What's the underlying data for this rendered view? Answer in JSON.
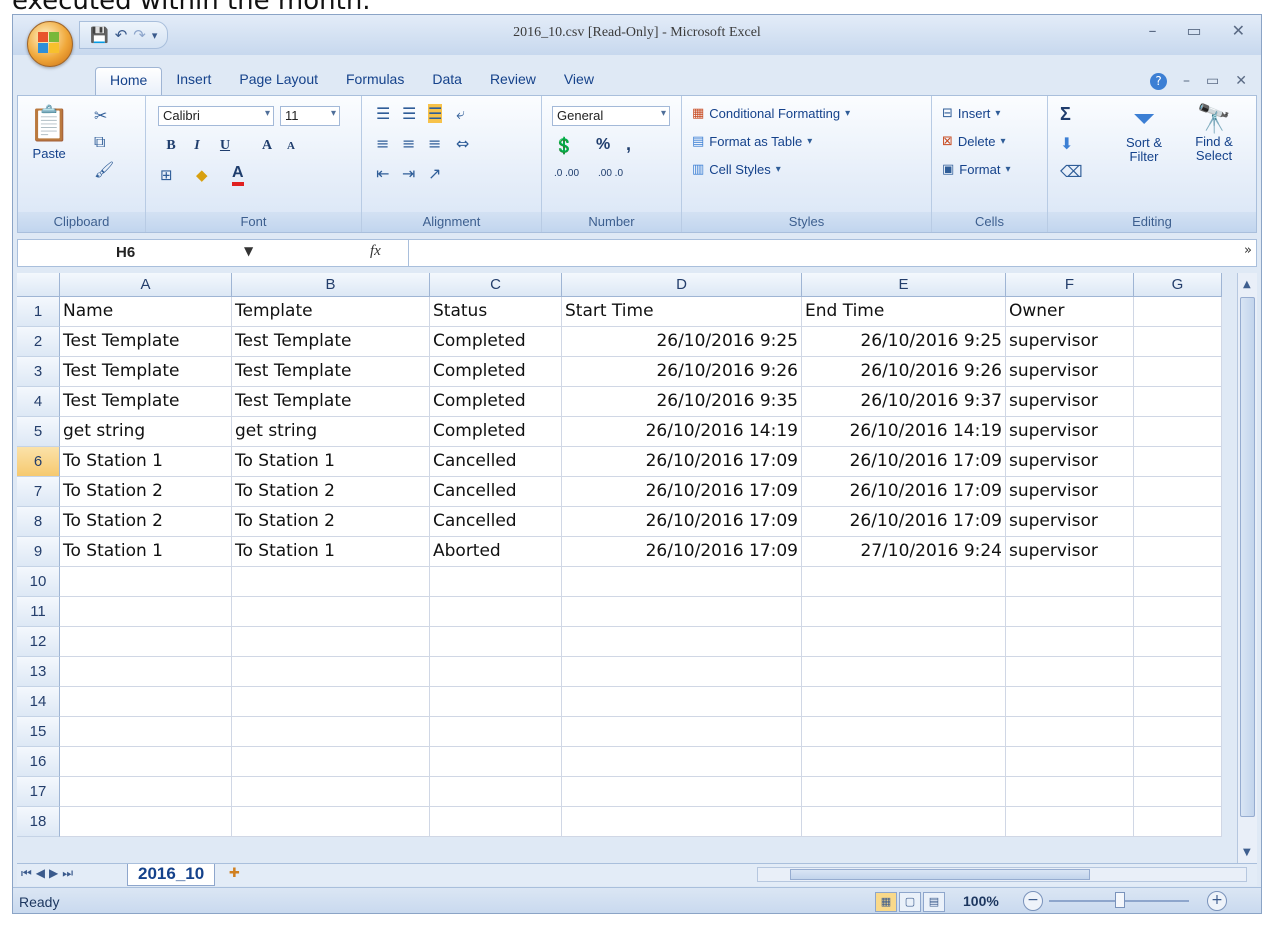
{
  "caption": "executed within the month.",
  "window": {
    "title": "2016_10.csv  [Read-Only] - Microsoft Excel",
    "minimize": "–",
    "restore": "▭",
    "close": "✕"
  },
  "tabs": [
    "Home",
    "Insert",
    "Page Layout",
    "Formulas",
    "Data",
    "Review",
    "View"
  ],
  "ribbon": {
    "clipboard": {
      "paste": "Paste",
      "label": "Clipboard"
    },
    "font": {
      "name": "Calibri",
      "size": "11",
      "label": "Font",
      "bold": "B",
      "italic": "I",
      "underline": "U",
      "grow": "A",
      "shrink": "A"
    },
    "alignment": {
      "label": "Alignment"
    },
    "number": {
      "format": "General",
      "percent": "%",
      "comma": ",",
      "inc_decimal": ".0 .00",
      "dec_decimal": ".00 .0",
      "label": "Number"
    },
    "styles": {
      "conditional": "Conditional Formatting",
      "format_table": "Format as Table",
      "cell_styles": "Cell Styles",
      "label": "Styles"
    },
    "cells": {
      "insert": "Insert",
      "delete": "Delete",
      "format": "Format",
      "label": "Cells"
    },
    "editing": {
      "sum": "Σ",
      "sort_filter": "Sort & Filter",
      "find_select": "Find & Select",
      "label": "Editing"
    }
  },
  "formula_bar": {
    "name_box": "H6",
    "fx": "fx",
    "value": ""
  },
  "columns": [
    "A",
    "B",
    "C",
    "D",
    "E",
    "F",
    "G"
  ],
  "rows": [
    [
      "Name",
      "Template",
      "Status",
      "Start Time",
      "End Time",
      "Owner",
      ""
    ],
    [
      "Test Template",
      "Test Template",
      "Completed",
      "26/10/2016 9:25",
      "26/10/2016 9:25",
      "supervisor",
      ""
    ],
    [
      "Test Template",
      "Test Template",
      "Completed",
      "26/10/2016 9:26",
      "26/10/2016 9:26",
      "supervisor",
      ""
    ],
    [
      "Test Template",
      "Test Template",
      "Completed",
      "26/10/2016 9:35",
      "26/10/2016 9:37",
      "supervisor",
      ""
    ],
    [
      "get string",
      "get string",
      "Completed",
      "26/10/2016 14:19",
      "26/10/2016 14:19",
      "supervisor",
      ""
    ],
    [
      "To Station 1",
      "To Station 1",
      "Cancelled",
      "26/10/2016 17:09",
      "26/10/2016 17:09",
      "supervisor",
      ""
    ],
    [
      "To Station 2",
      "To Station 2",
      "Cancelled",
      "26/10/2016 17:09",
      "26/10/2016 17:09",
      "supervisor",
      ""
    ],
    [
      "To Station 2",
      "To Station 2",
      "Cancelled",
      "26/10/2016 17:09",
      "26/10/2016 17:09",
      "supervisor",
      ""
    ],
    [
      "To Station 1",
      "To Station 1",
      "Aborted",
      "26/10/2016 17:09",
      "27/10/2016 9:24",
      "supervisor",
      ""
    ],
    [
      "",
      "",
      "",
      "",
      "",
      "",
      ""
    ],
    [
      "",
      "",
      "",
      "",
      "",
      "",
      ""
    ],
    [
      "",
      "",
      "",
      "",
      "",
      "",
      ""
    ],
    [
      "",
      "",
      "",
      "",
      "",
      "",
      ""
    ],
    [
      "",
      "",
      "",
      "",
      "",
      "",
      ""
    ],
    [
      "",
      "",
      "",
      "",
      "",
      "",
      ""
    ],
    [
      "",
      "",
      "",
      "",
      "",
      "",
      ""
    ],
    [
      "",
      "",
      "",
      "",
      "",
      "",
      ""
    ],
    [
      "",
      "",
      "",
      "",
      "",
      "",
      ""
    ]
  ],
  "selected_row": 6,
  "sheet": {
    "name": "2016_10"
  },
  "status": {
    "ready": "Ready",
    "zoom": "100%"
  },
  "colors": {
    "accent": "#15428b",
    "selected_header": "#f6c96f"
  }
}
